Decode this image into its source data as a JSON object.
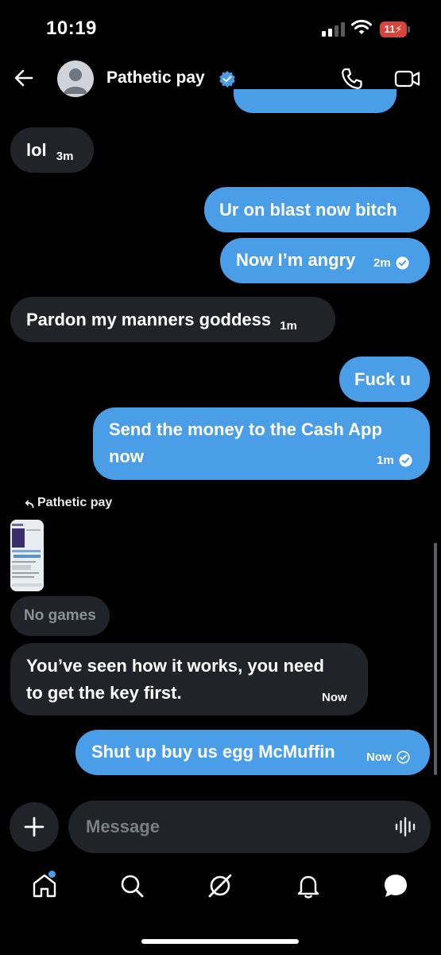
{
  "status_bar": {
    "time": "10:19",
    "battery": "11"
  },
  "header": {
    "contact_name": "Pathetic pay"
  },
  "messages": [
    {
      "text": "lol",
      "time": "3m"
    },
    {
      "text": "Ur on blast now bitch"
    },
    {
      "text": "Now I’m angry",
      "time": "2m"
    },
    {
      "text": "Pardon my manners goddess",
      "time": "1m"
    },
    {
      "text": "Fuck u"
    },
    {
      "text": "Send the money to the Cash App now",
      "line1": "Send the money to the Cash App",
      "line2": "now",
      "time": "1m"
    },
    {
      "reply_to": "Pathetic pay"
    },
    {
      "text": "No games"
    },
    {
      "line1": "You’ve seen how it works, you need",
      "line2": "to get the key first.",
      "time": "Now"
    },
    {
      "text": "Shut up buy us egg McMuffin",
      "time": "Now"
    }
  ],
  "composer": {
    "placeholder": "Message"
  },
  "tabs": [
    "home-icon",
    "search-icon",
    "grok-icon",
    "notifications-icon",
    "messages-icon"
  ],
  "colors": {
    "outgoing": "#4a9ee8",
    "incoming": "#202327",
    "accent": "#4a9ee8"
  }
}
